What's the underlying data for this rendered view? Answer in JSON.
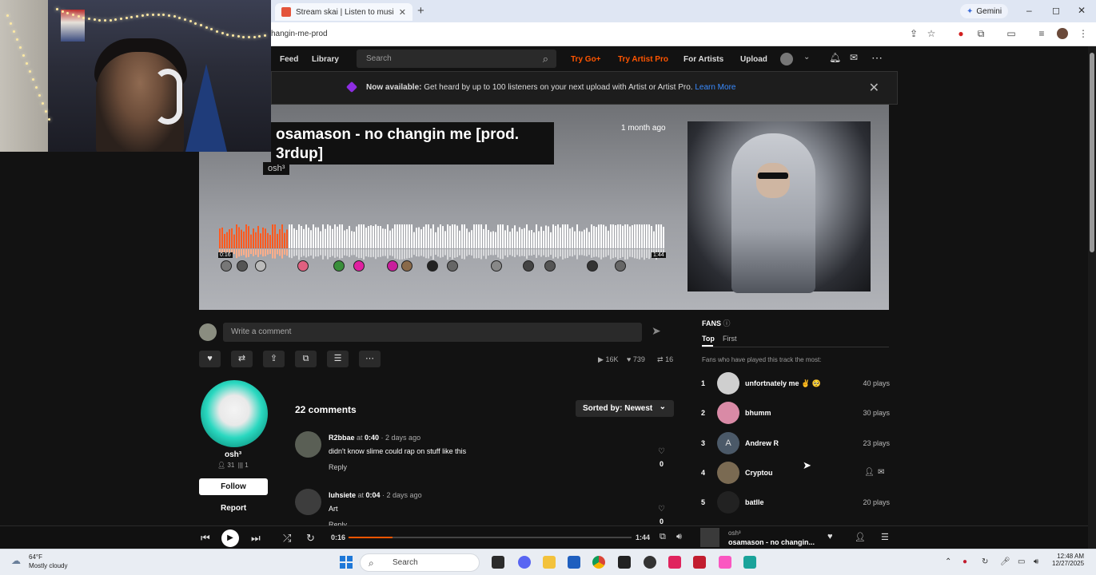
{
  "browser": {
    "tab_title": "Stream skai | Listen to music albums",
    "new_tab": "+",
    "gemini_label": "Gemini",
    "url": "hangin-me-prod",
    "window_controls": [
      "–",
      "◻",
      "✕"
    ]
  },
  "sc_header": {
    "nav": [
      "Feed",
      "Library"
    ],
    "search_placeholder": "Search",
    "try_go": "Try Go+",
    "try_artist_pro": "Try Artist Pro",
    "for_artists": "For Artists",
    "upload": "Upload",
    "more": "⋯"
  },
  "banner": {
    "bold": "Now available:",
    "text": " Get heard by up to 100 listeners on your next upload with Artist or Artist Pro.",
    "link": "Learn More",
    "link_color": "#3a8bff"
  },
  "hero": {
    "title": "osamason - no changin me [prod.\n3rdup]",
    "artist": "osh³",
    "posted": "1 month ago",
    "time_current": "0:16",
    "time_total": "1:44",
    "played_fraction": 0.154
  },
  "comment_box": {
    "placeholder": "Write a comment"
  },
  "stats": {
    "plays": "16K",
    "likes": "739",
    "reposts": "16"
  },
  "artist_card": {
    "name": "osh³",
    "followers": "31",
    "tracks": "1",
    "follow_label": "Follow",
    "report_label": "Report"
  },
  "comments": {
    "count_label": "22 comments",
    "sort_label": "Sorted by: Newest",
    "items": [
      {
        "user": "R2bbae",
        "at_label": " at ",
        "time": "0:40",
        "ago": " · 2 days ago",
        "text": "didn't know slime could rap on stuff like this",
        "reply": "Reply",
        "likes": "0"
      },
      {
        "user": "luhsiete",
        "at_label": " at ",
        "time": "0:04",
        "ago": " · 2 days ago",
        "text": "Art",
        "reply": "Reply",
        "likes": "0"
      }
    ]
  },
  "fans": {
    "title": "FANS",
    "tabs": [
      "Top",
      "First"
    ],
    "subtitle": "Fans who have played this track the most:",
    "items": [
      {
        "rank": "1",
        "name": "unfortnately me ✌️ 🥺",
        "plays": "40 plays",
        "initial": ""
      },
      {
        "rank": "2",
        "name": "bhumm",
        "plays": "30 plays",
        "initial": ""
      },
      {
        "rank": "3",
        "name": "Andrew R",
        "plays": "23 plays",
        "initial": "A"
      },
      {
        "rank": "4",
        "name": "Cryptou",
        "plays": "",
        "initial": ""
      },
      {
        "rank": "5",
        "name": "batlle",
        "plays": "20 plays",
        "initial": ""
      }
    ]
  },
  "player": {
    "time_current": "0:16",
    "time_total": "1:44",
    "progress_fraction": 0.154,
    "artist": "osh³",
    "track": "osamason - no changin..."
  },
  "taskbar": {
    "temp": "64°F",
    "condition": "Mostly cloudy",
    "search_label": "Search",
    "time": "12:48 AM",
    "date": "12/27/2025"
  },
  "colors": {
    "accent": "#ff5500",
    "background": "#121212"
  }
}
